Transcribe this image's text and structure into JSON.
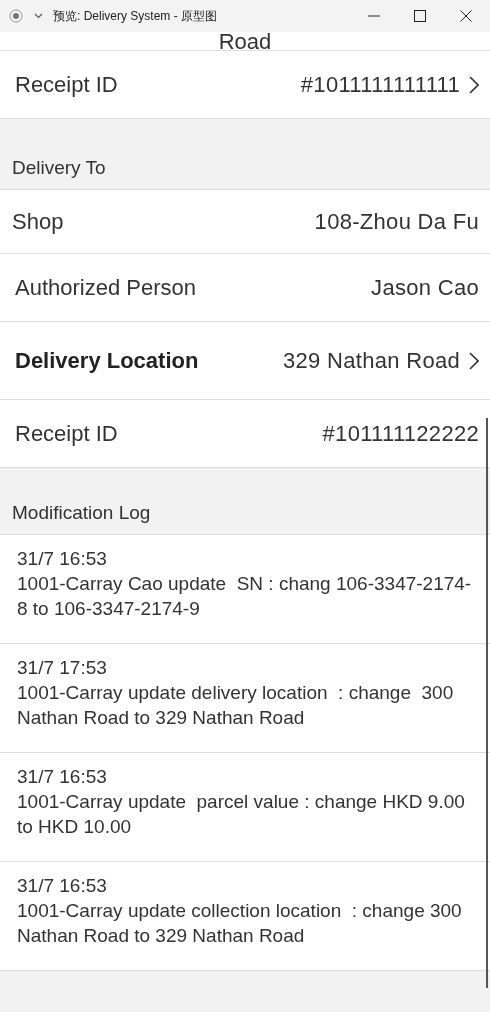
{
  "window": {
    "title": "预览: Delivery System - 原型图"
  },
  "cut_text": "Road",
  "top_rows": [
    {
      "label": "Receipt ID",
      "value": "#1011111111111",
      "kind": "link",
      "emphasized": false
    }
  ],
  "delivery_to": {
    "heading": "Delivery To",
    "rows": [
      {
        "label": "Shop",
        "value": "108-Zhou Da Fu",
        "kind": "plain",
        "emphasized": false
      },
      {
        "label": "Authorized Person",
        "value": "Jason Cao",
        "kind": "plain",
        "emphasized": false
      },
      {
        "label": "Delivery Location",
        "value": "329 Nathan Road",
        "kind": "link",
        "emphasized": true
      },
      {
        "label": "Receipt ID",
        "value": "#101111122222",
        "kind": "plain",
        "emphasized": false
      }
    ]
  },
  "modification_log": {
    "heading": "Modification Log",
    "entries": [
      {
        "time": "31/7 16:53",
        "text": "1001-Carray Cao update  SN : chang 106-3347-2174-8 to 106-3347-2174-9"
      },
      {
        "time": "31/7 17:53",
        "text": "1001-Carray update delivery location  : change  300 Nathan Road to 329 Nathan Road"
      },
      {
        "time": "31/7 16:53",
        "text": "1001-Carray update  parcel value : change HKD 9.00 to HKD 10.00"
      },
      {
        "time": "31/7 16:53",
        "text": "1001-Carray update collection location  : change 300 Nathan Road to 329 Nathan Road"
      }
    ]
  }
}
